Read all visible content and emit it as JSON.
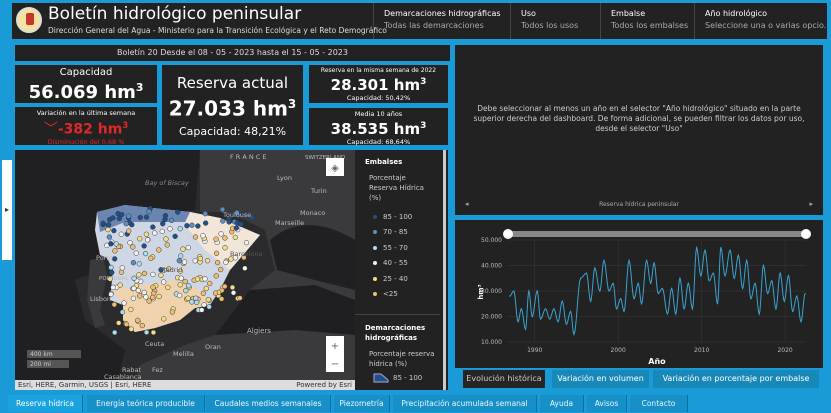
{
  "header": {
    "title": "Boletín hidrológico peninsular",
    "subtitle": "Dirección General del Agua - Ministerio para la Transición Ecológica y el Reto Demográfico",
    "filters": [
      {
        "label": "Demarcaciones hidrográficas",
        "value": "Todas las demarcaciones"
      },
      {
        "label": "Uso",
        "value": "Todos los usos"
      },
      {
        "label": "Embalse",
        "value": "Todos los embalses"
      },
      {
        "label": "Año hidrológico",
        "value": "Seleccione una o varias opcio..."
      }
    ]
  },
  "bulletin": "Boletín 20 Desde el  08 - 05 - 2023 hasta el  15 - 05 - 2023",
  "kpis": {
    "capacidad": {
      "label": "Capacidad",
      "value": "56.069 hm",
      "unit_sup": "3"
    },
    "variacion": {
      "label": "Variación en la última semana",
      "value": "-382 hm",
      "unit_sup": "3",
      "sub": "Disminución del 0,68 %",
      "color": "#e0282a"
    },
    "reserva": {
      "label": "Reserva actual",
      "value": "27.033 hm",
      "unit_sup": "3",
      "sub": "Capacidad: 48,21%"
    },
    "reserva2022": {
      "label": "Reserva en la misma semana de 2022",
      "value": "28.301 hm",
      "unit_sup": "3",
      "sub": "Capacidad: 50,42%"
    },
    "media10": {
      "label": "Media 10 años",
      "value": "38.535 hm",
      "unit_sup": "3",
      "sub": "Capacidad: 68,64%"
    }
  },
  "map": {
    "labels": {
      "france": "F R A N C E",
      "switzerland": "SWITZERLAND",
      "lyon": "Lyon",
      "turin": "Turin",
      "biscay": "Bay of Biscay",
      "toulouse": "Toulouse",
      "monaco": "Monaco",
      "marseille": "Marseille",
      "porto": "Porto",
      "portugal": "PORTUGAL",
      "lisbon": "Lisbon",
      "barcelona": "Barcelona",
      "madrid": "Madrid",
      "algiers": "Algiers",
      "ceuta": "Ceuta",
      "oran": "Oran",
      "melilla": "Melilla",
      "rabat": "Rabat",
      "fez": "Fez",
      "casablanca": "Casablanca"
    },
    "scale_km": "400 km",
    "scale_mi": "200 mi",
    "attribution": "Esri, HERE, Garmin, USGS | Esri, HERE",
    "powered": "Powered by Esri",
    "zoom_in": "+",
    "zoom_out": "−"
  },
  "legend": {
    "title": "Embalses",
    "subtitle": "Porcentaje Reserva Hídrica (%)",
    "items": [
      {
        "label": "85 - 100",
        "color": "#1f4f8f"
      },
      {
        "label": "70 - 85",
        "color": "#5a8fc6"
      },
      {
        "label": "55 - 70",
        "color": "#a9dcec"
      },
      {
        "label": "40 - 55",
        "color": "#f2f2f2"
      },
      {
        "label": "25 - 40",
        "color": "#f3df86"
      },
      {
        "label": "<25",
        "color": "#efbe72"
      }
    ],
    "title2": "Demarcaciones hidrográficas",
    "subtitle2": "Porcentaje reserva hídrica (%)",
    "item2": "85 - 100",
    "item2_color": "#1f4f8f"
  },
  "info": {
    "message": "Debe seleccionar al menos un año en el selector \"Año hidrológico\" situado en la parte superior derecha del dashboard. De forma adicional, se pueden filtrar los datos por uso, desde el selector \"Uso\"",
    "footer": "Reserva hídrica peninsular"
  },
  "chart_tabs": [
    "Evolución histórica",
    "Variación en volumen",
    "Variación en porcentaje por embalse"
  ],
  "nav": [
    "Reserva hídrica",
    "Energía teórica producible",
    "Caudales medios semanales",
    "Piezometría",
    "Precipitación acumulada semanal",
    "Ayuda",
    "Avisos",
    "Contacto"
  ],
  "chart_data": {
    "type": "line",
    "xlabel": "Año",
    "ylabel": "hm³",
    "xlim": [
      1986.8,
      2022.5
    ],
    "ylim": [
      10000,
      50000
    ],
    "xticks": [
      1990,
      2000,
      2010,
      2020
    ],
    "yticks": [
      "10.000",
      "20.000",
      "30.000",
      "40.000",
      "50.000"
    ],
    "ytick_values": [
      10000,
      20000,
      30000,
      40000,
      50000
    ],
    "color": "#3aa3d0",
    "grid": true,
    "x": [
      1987.0,
      1987.5,
      1988.0,
      1988.4,
      1988.9,
      1989.3,
      1989.7,
      1990.3,
      1990.7,
      1991.3,
      1991.8,
      1992.3,
      1992.8,
      1993.3,
      1993.8,
      1994.3,
      1994.7,
      1995.5,
      1996.2,
      1996.7,
      1997.2,
      1997.8,
      1998.3,
      1998.9,
      1999.4,
      1999.8,
      2000.3,
      2000.7,
      2001.3,
      2001.9,
      2002.4,
      2002.8,
      2003.4,
      2003.9,
      2004.3,
      2004.8,
      2005.3,
      2005.9,
      2006.4,
      2006.9,
      2007.4,
      2007.9,
      2008.4,
      2008.9,
      2009.4,
      2009.9,
      2010.4,
      2010.9,
      2011.4,
      2011.9,
      2012.3,
      2012.8,
      2013.4,
      2013.9,
      2014.4,
      2014.9,
      2015.4,
      2015.9,
      2016.4,
      2016.9,
      2017.4,
      2017.9,
      2018.4,
      2018.9,
      2019.4,
      2019.9,
      2020.4,
      2020.9,
      2021.4,
      2021.9,
      2022.4
    ],
    "y": [
      28000,
      30000,
      18000,
      23000,
      15000,
      30000,
      20000,
      30000,
      19000,
      23000,
      19000,
      23000,
      18000,
      26000,
      17000,
      22000,
      13000,
      35000,
      37000,
      26000,
      39000,
      30000,
      42000,
      30000,
      33000,
      23000,
      27000,
      22000,
      42000,
      27000,
      33000,
      25000,
      42000,
      33000,
      41000,
      29000,
      31000,
      21000,
      31000,
      21000,
      35000,
      23000,
      33000,
      23000,
      47000,
      36000,
      46000,
      34000,
      37000,
      25000,
      47000,
      36000,
      46000,
      35000,
      44000,
      31000,
      42000,
      27000,
      33000,
      21000,
      40000,
      29000,
      34000,
      23000,
      37000,
      26000,
      36000,
      22000,
      28000,
      18000,
      29000
    ]
  }
}
